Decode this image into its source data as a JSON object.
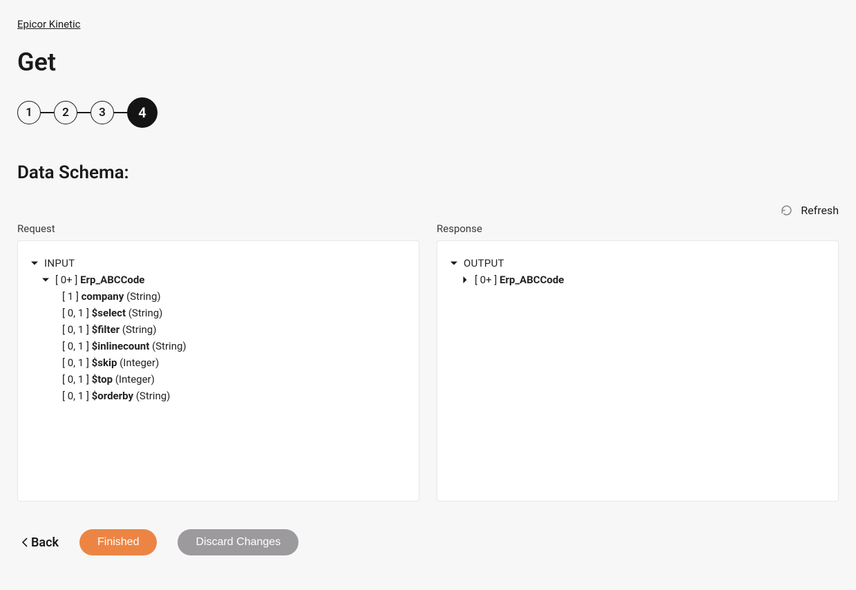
{
  "breadcrumb": "Epicor Kinetic",
  "page_title": "Get",
  "stepper": {
    "steps": [
      "1",
      "2",
      "3",
      "4"
    ],
    "active_index": 3
  },
  "section_title": "Data Schema:",
  "refresh_label": "Refresh",
  "request": {
    "label": "Request",
    "root": "INPUT",
    "entity": {
      "cardinality": "[ 0+ ]",
      "name": "Erp_ABCCode"
    },
    "fields": [
      {
        "cardinality": "[ 1 ]",
        "name": "company",
        "type": "(String)"
      },
      {
        "cardinality": "[ 0, 1 ]",
        "name": "$select",
        "type": "(String)"
      },
      {
        "cardinality": "[ 0, 1 ]",
        "name": "$filter",
        "type": "(String)"
      },
      {
        "cardinality": "[ 0, 1 ]",
        "name": "$inlinecount",
        "type": "(String)"
      },
      {
        "cardinality": "[ 0, 1 ]",
        "name": "$skip",
        "type": "(Integer)"
      },
      {
        "cardinality": "[ 0, 1 ]",
        "name": "$top",
        "type": "(Integer)"
      },
      {
        "cardinality": "[ 0, 1 ]",
        "name": "$orderby",
        "type": "(String)"
      }
    ]
  },
  "response": {
    "label": "Response",
    "root": "OUTPUT",
    "entity": {
      "cardinality": "[ 0+ ]",
      "name": "Erp_ABCCode"
    }
  },
  "footer": {
    "back": "Back",
    "finished": "Finished",
    "discard": "Discard Changes"
  }
}
